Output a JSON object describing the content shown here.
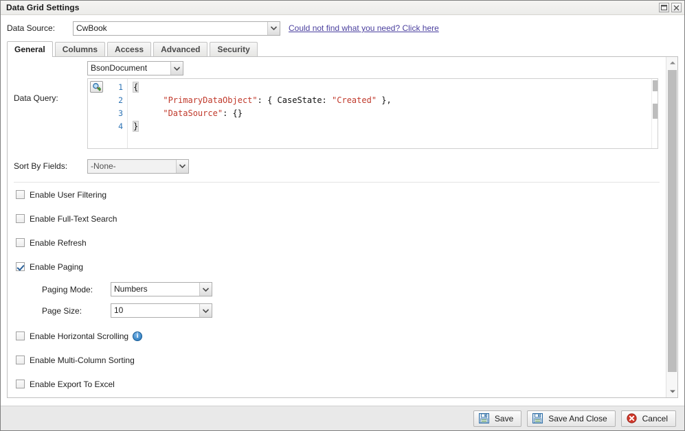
{
  "window": {
    "title": "Data Grid Settings",
    "controls": [
      {
        "name": "restore",
        "glyph": "restore-icon"
      },
      {
        "name": "close",
        "glyph": "close-icon"
      }
    ]
  },
  "data_source": {
    "label": "Data Source:",
    "value": "CwBook",
    "help_link": "Could not find what you need? Click here"
  },
  "tabs": [
    {
      "label": "General",
      "active": true
    },
    {
      "label": "Columns",
      "active": false
    },
    {
      "label": "Access",
      "active": false
    },
    {
      "label": "Advanced",
      "active": false
    },
    {
      "label": "Security",
      "active": false
    }
  ],
  "data_query": {
    "label": "Data Query:",
    "type_value": "BsonDocument",
    "gutter_icon": "magnifier-plus-icon",
    "lines": [
      "1",
      "2",
      "3",
      "4"
    ],
    "code": {
      "line1": "{",
      "line2_str1": "\"PrimaryDataObject\"",
      "line2_mid": ": { CaseState: ",
      "line2_str2": "\"Created\"",
      "line2_end": " },",
      "line3_str1": "\"DataSource\"",
      "line3_end": ": {}",
      "line4": "}"
    }
  },
  "sort_by": {
    "label": "Sort By Fields:",
    "value": "-None-"
  },
  "options": [
    {
      "label": "Enable User Filtering",
      "checked": false,
      "info": false
    },
    {
      "label": "Enable Full-Text Search",
      "checked": false,
      "info": false
    },
    {
      "label": "Enable Refresh",
      "checked": false,
      "info": false
    },
    {
      "label": "Enable Paging",
      "checked": true,
      "info": false
    }
  ],
  "paging": {
    "mode_label": "Paging Mode:",
    "mode_value": "Numbers",
    "size_label": "Page Size:",
    "size_value": "10"
  },
  "options2": [
    {
      "label": "Enable Horizontal Scrolling",
      "checked": false,
      "info": true,
      "info_glyph": "i"
    },
    {
      "label": "Enable Multi-Column Sorting",
      "checked": false,
      "info": false
    },
    {
      "label": "Enable Export To Excel",
      "checked": false,
      "info": false
    }
  ],
  "footer": {
    "save": "Save",
    "save_and_close": "Save And Close",
    "cancel": "Cancel"
  },
  "colors": {
    "link": "#4a3f9e",
    "string_literal": "#c0392b",
    "line_number": "#2e74b5",
    "footer_bg": "#e9e9e9",
    "check_mark": "#2a6099"
  }
}
